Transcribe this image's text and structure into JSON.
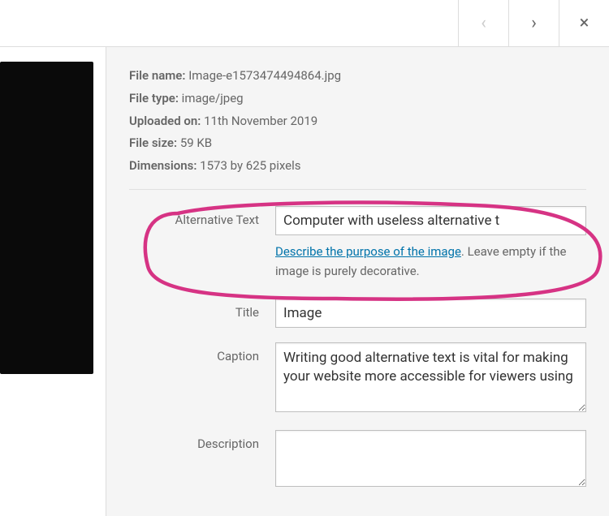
{
  "topbar": {
    "prev": "‹",
    "next": "›",
    "close": "×"
  },
  "meta": {
    "filename_label": "File name:",
    "filename_value": "Image-e1573474494864.jpg",
    "filetype_label": "File type:",
    "filetype_value": "image/jpeg",
    "uploaded_label": "Uploaded on:",
    "uploaded_value": "11th November 2019",
    "filesize_label": "File size:",
    "filesize_value": "59 KB",
    "dimensions_label": "Dimensions:",
    "dimensions_value": "1573 by 625 pixels"
  },
  "fields": {
    "alt_label": "Alternative Text",
    "alt_value": "Computer with useless alternative t",
    "alt_help_link": "Describe the purpose of the image",
    "alt_help_suffix": ". Leave empty if the image is purely decorative.",
    "title_label": "Title",
    "title_value": "Image",
    "caption_label": "Caption",
    "caption_value": "Writing good alternative text is vital for making your website more accessible for viewers using",
    "description_label": "Description",
    "description_value": ""
  }
}
